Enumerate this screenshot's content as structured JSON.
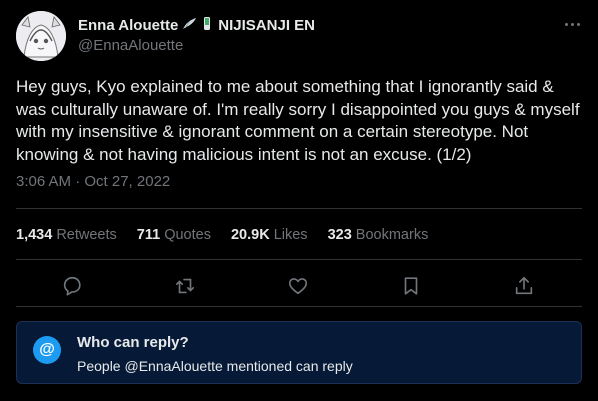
{
  "author": {
    "display_name": "Enna Alouette",
    "affiliation": "NIJISANJI EN",
    "handle": "@EnnaAlouette",
    "badge_icons": [
      "bird-wing-icon",
      "phone-tag-icon"
    ]
  },
  "tweet": {
    "text": "Hey guys, Kyo explained to me about something that I ignorantly said & was culturally unaware of. I'm really sorry I disappointed you guys & myself with my insensitive & ignorant comment on a certain stereotype. Not knowing & not having malicious intent is not an excuse. (1/2)",
    "timestamp": "3:06 AM · Oct 27, 2022"
  },
  "stats": {
    "retweets": {
      "count": "1,434",
      "label": "Retweets"
    },
    "quotes": {
      "count": "711",
      "label": "Quotes"
    },
    "likes": {
      "count": "20.9K",
      "label": "Likes"
    },
    "bookmarks": {
      "count": "323",
      "label": "Bookmarks"
    }
  },
  "actions": [
    "reply-icon",
    "retweet-icon",
    "like-icon",
    "bookmark-icon",
    "share-icon"
  ],
  "reply_restriction": {
    "icon": "at-icon",
    "symbol": "@",
    "title": "Who can reply?",
    "subtitle": "People @EnnaAlouette mentioned can reply"
  },
  "colors": {
    "background": "#000000",
    "text": "#e7e9ea",
    "muted": "#71767b",
    "accent": "#1d9bf0",
    "notice_bg": "#061a37"
  }
}
